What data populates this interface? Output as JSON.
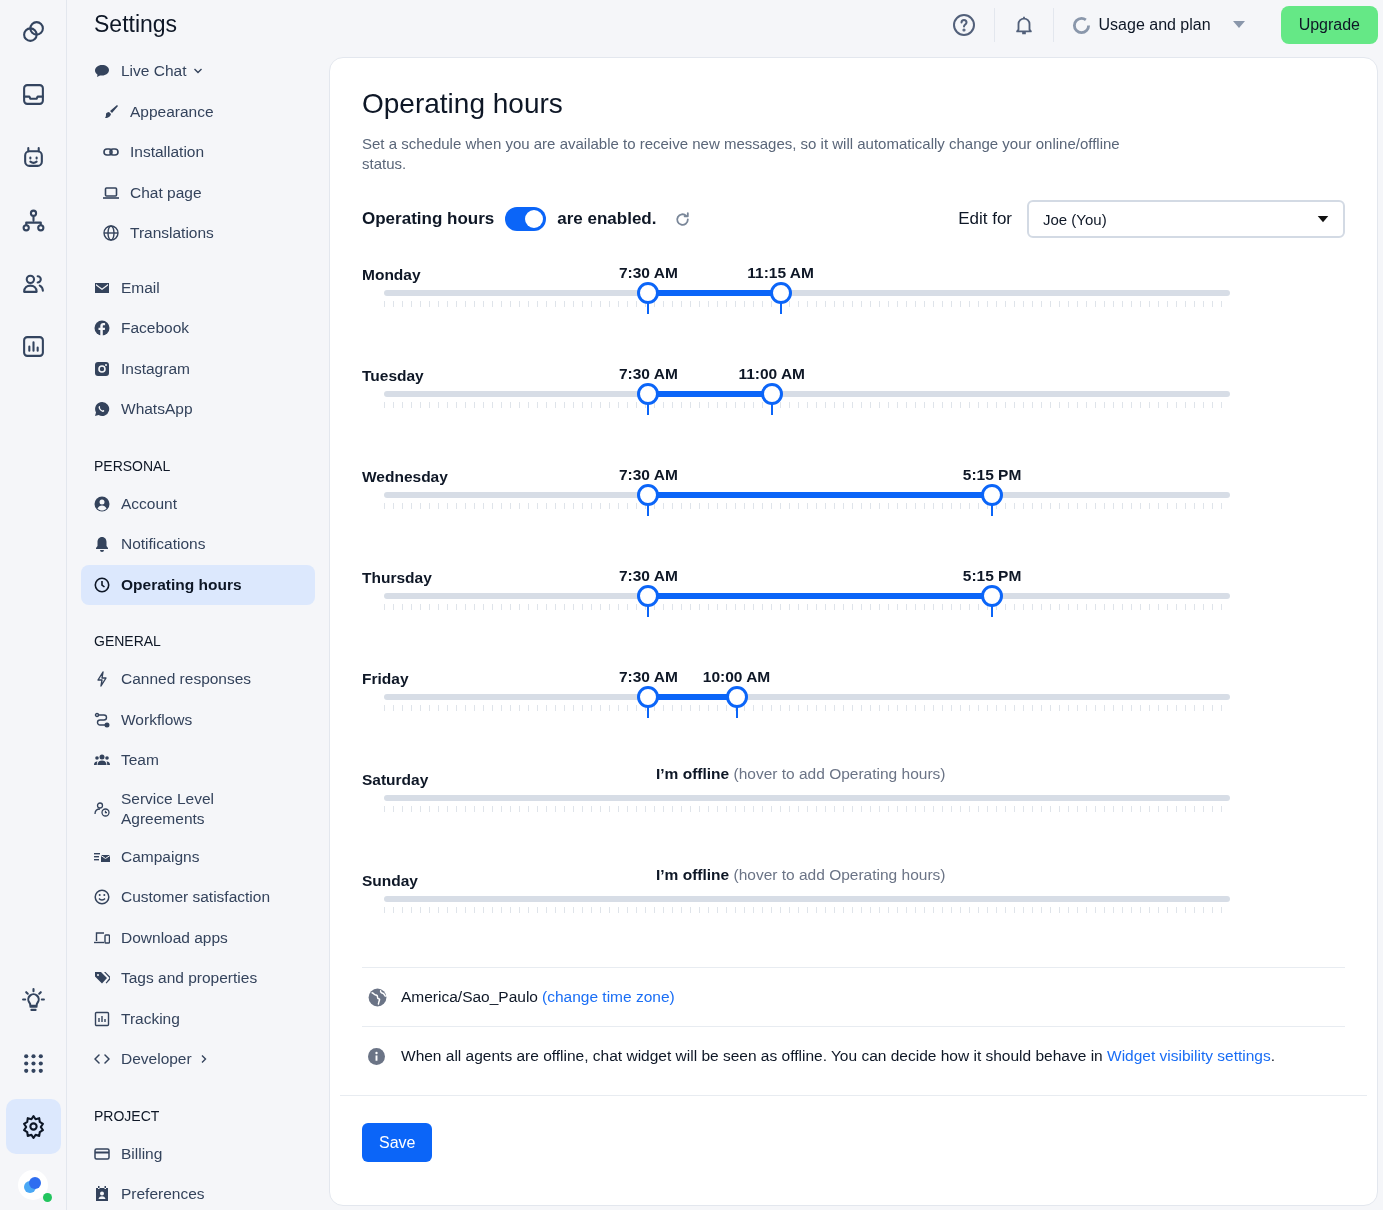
{
  "rail": {
    "top": [
      {
        "selected": false
      },
      {
        "selected": false
      },
      {
        "selected": false
      },
      {
        "selected": false
      },
      {
        "selected": false
      },
      {
        "selected": false
      }
    ],
    "bottom": [
      {
        "selected": false
      },
      {
        "selected": false
      },
      {
        "selected": true
      }
    ],
    "avatar": {
      "online": true
    }
  },
  "sidebar": {
    "title": "Settings",
    "sections": [
      {
        "items": [
          {
            "label": "Live Chat",
            "selected": false,
            "expanded": true,
            "children": [
              {
                "label": "Appearance",
                "selected": false
              },
              {
                "label": "Installation",
                "selected": false
              },
              {
                "label": "Chat page",
                "selected": false
              },
              {
                "label": "Translations",
                "selected": false
              }
            ]
          },
          {
            "label": "Email",
            "selected": false
          },
          {
            "label": "Facebook",
            "selected": false
          },
          {
            "label": "Instagram",
            "selected": false
          },
          {
            "label": "WhatsApp",
            "selected": false
          }
        ]
      },
      {
        "heading": "PERSONAL",
        "items": [
          {
            "label": "Account",
            "selected": false
          },
          {
            "label": "Notifications",
            "selected": false
          },
          {
            "label": "Operating hours",
            "selected": true
          }
        ]
      },
      {
        "heading": "GENERAL",
        "items": [
          {
            "label": "Canned responses",
            "selected": false
          },
          {
            "label": "Workflows",
            "selected": false
          },
          {
            "label": "Team",
            "selected": false
          },
          {
            "label": "Service Level Agreements",
            "selected": false
          },
          {
            "label": "Campaigns",
            "selected": false
          },
          {
            "label": "Customer satisfaction",
            "selected": false
          },
          {
            "label": "Download apps",
            "selected": false
          },
          {
            "label": "Tags and properties",
            "selected": false
          },
          {
            "label": "Tracking",
            "selected": false
          },
          {
            "label": "Developer",
            "selected": false,
            "expanded": false
          }
        ]
      },
      {
        "heading": "PROJECT",
        "items": [
          {
            "label": "Billing",
            "selected": false
          },
          {
            "label": "Preferences",
            "selected": false
          }
        ]
      }
    ]
  },
  "header": {
    "usage": "Usage and plan",
    "upgrade": "Upgrade"
  },
  "page": {
    "title": "Operating hours",
    "description": "Set a schedule when you are available to receive new messages, so it will automatically change your online/offline status.",
    "toggle": {
      "label_before": "Operating hours",
      "on": true,
      "label_after": "are enabled."
    },
    "edit_for": {
      "label": "Edit for",
      "value": "Joe (You)"
    },
    "days": [
      {
        "kind": "range",
        "name": "Monday",
        "start": {
          "label": "7:30 AM",
          "level": 0.3125
        },
        "end": {
          "label": "11:15 AM",
          "level": 0.46875
        }
      },
      {
        "kind": "range",
        "name": "Tuesday",
        "start": {
          "label": "7:30 AM",
          "level": 0.3125
        },
        "end": {
          "label": "11:00 AM",
          "level": 0.4583
        }
      },
      {
        "kind": "range",
        "name": "Wednesday",
        "start": {
          "label": "7:30 AM",
          "level": 0.3125
        },
        "end": {
          "label": "5:15 PM",
          "level": 0.71875
        }
      },
      {
        "kind": "range",
        "name": "Thursday",
        "start": {
          "label": "7:30 AM",
          "level": 0.3125
        },
        "end": {
          "label": "5:15 PM",
          "level": 0.71875
        }
      },
      {
        "kind": "range",
        "name": "Friday",
        "start": {
          "label": "7:30 AM",
          "level": 0.3125
        },
        "end": {
          "label": "10:00 AM",
          "level": 0.4167
        }
      },
      {
        "kind": "offline",
        "name": "Saturday",
        "status": "I’m offline",
        "hint": "(hover to add Operating hours)"
      },
      {
        "kind": "offline",
        "name": "Sunday",
        "status": "I’m offline",
        "hint": "(hover to add Operating hours)"
      }
    ],
    "timezone": {
      "value": "America/Sao_Paulo",
      "link": "(change time zone)"
    },
    "info": {
      "text": "When all agents are offline, chat widget will be seen as offline. You can decide how it should behave in",
      "link": "Widget visibility settings",
      "after": "."
    },
    "save": "Save"
  }
}
